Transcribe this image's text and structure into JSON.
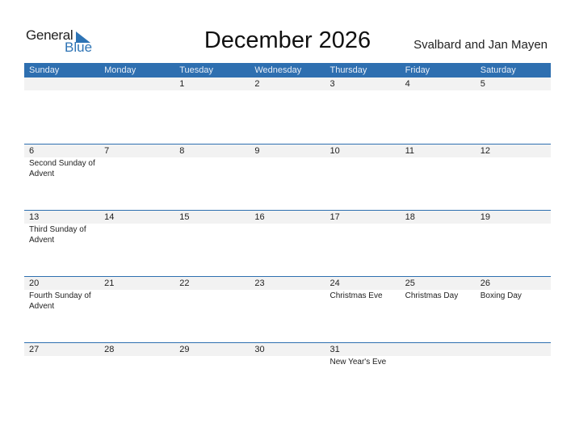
{
  "logo": {
    "general": "General",
    "blue": "Blue"
  },
  "title": "December 2026",
  "region": "Svalbard and Jan Mayen",
  "colors": {
    "accent": "#2e6fb0",
    "daybar": "#f2f2f2"
  },
  "weekdays": [
    "Sunday",
    "Monday",
    "Tuesday",
    "Wednesday",
    "Thursday",
    "Friday",
    "Saturday"
  ],
  "weeks": [
    {
      "days": [
        "",
        "",
        "1",
        "2",
        "3",
        "4",
        "5"
      ],
      "events": [
        "",
        "",
        "",
        "",
        "",
        "",
        ""
      ]
    },
    {
      "days": [
        "6",
        "7",
        "8",
        "9",
        "10",
        "11",
        "12"
      ],
      "events": [
        "Second Sunday of Advent",
        "",
        "",
        "",
        "",
        "",
        ""
      ]
    },
    {
      "days": [
        "13",
        "14",
        "15",
        "16",
        "17",
        "18",
        "19"
      ],
      "events": [
        "Third Sunday of Advent",
        "",
        "",
        "",
        "",
        "",
        ""
      ]
    },
    {
      "days": [
        "20",
        "21",
        "22",
        "23",
        "24",
        "25",
        "26"
      ],
      "events": [
        "Fourth Sunday of Advent",
        "",
        "",
        "",
        "Christmas Eve",
        "Christmas Day",
        "Boxing Day"
      ]
    },
    {
      "days": [
        "27",
        "28",
        "29",
        "30",
        "31",
        "",
        ""
      ],
      "events": [
        "",
        "",
        "",
        "",
        "New Year's Eve",
        "",
        ""
      ]
    }
  ]
}
